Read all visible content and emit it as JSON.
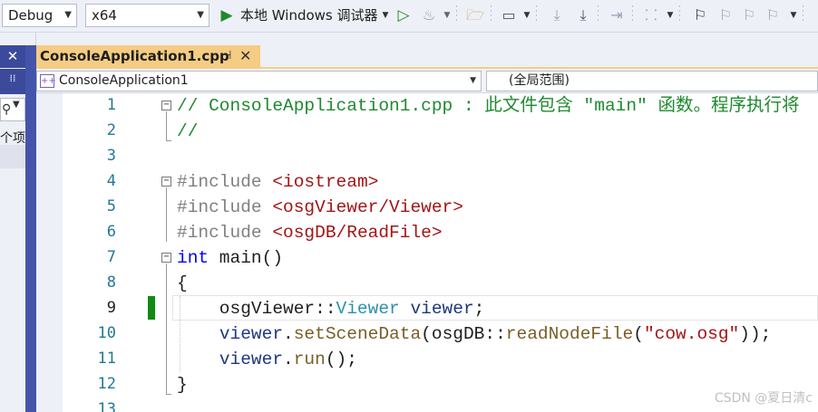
{
  "toolbar": {
    "config_value": "Debug",
    "platform_value": "x64",
    "run_target_label": "本地 Windows 调试器"
  },
  "left_panel": {
    "close_glyph": "✕",
    "truncated_label": "个项"
  },
  "tab": {
    "title": "ConsoleApplication1.cpp"
  },
  "navbar": {
    "project": "ConsoleApplication1",
    "scope": "(全局范围)"
  },
  "editor": {
    "line_numbers": [
      "1",
      "2",
      "3",
      "4",
      "5",
      "6",
      "7",
      "8",
      "9",
      "10",
      "11",
      "12",
      "13"
    ],
    "lines": [
      [
        {
          "t": "// ConsoleApplication1.cpp : 此文件包含 \"main\" 函数。程序执行将",
          "c": "cm"
        }
      ],
      [
        {
          "t": "//",
          "c": "cm"
        }
      ],
      [],
      [
        {
          "t": "#include ",
          "c": "pp"
        },
        {
          "t": "<iostream>",
          "c": "hd"
        }
      ],
      [
        {
          "t": "#include ",
          "c": "pp"
        },
        {
          "t": "<osgViewer/Viewer>",
          "c": "hd"
        }
      ],
      [
        {
          "t": "#include ",
          "c": "pp"
        },
        {
          "t": "<osgDB/ReadFile>",
          "c": "hd"
        }
      ],
      [
        {
          "t": "int",
          "c": "kw"
        },
        {
          "t": " main()",
          "c": ""
        }
      ],
      [
        {
          "t": "{",
          "c": ""
        }
      ],
      [
        {
          "t": "    osgViewer::",
          "c": ""
        },
        {
          "t": "Viewer",
          "c": "ty"
        },
        {
          "t": " ",
          "c": ""
        },
        {
          "t": "viewer",
          "c": "id"
        },
        {
          "t": ";",
          "c": ""
        }
      ],
      [
        {
          "t": "    ",
          "c": ""
        },
        {
          "t": "viewer",
          "c": "id"
        },
        {
          "t": ".",
          "c": ""
        },
        {
          "t": "setSceneData",
          "c": "fn"
        },
        {
          "t": "(osgDB::",
          "c": ""
        },
        {
          "t": "readNodeFile",
          "c": "fn"
        },
        {
          "t": "(",
          "c": ""
        },
        {
          "t": "\"cow.osg\"",
          "c": "str"
        },
        {
          "t": "));",
          "c": ""
        }
      ],
      [
        {
          "t": "    ",
          "c": ""
        },
        {
          "t": "viewer",
          "c": "id"
        },
        {
          "t": ".",
          "c": ""
        },
        {
          "t": "run",
          "c": "fn"
        },
        {
          "t": "();",
          "c": ""
        }
      ],
      [
        {
          "t": "}",
          "c": ""
        }
      ],
      []
    ]
  },
  "watermark": "CSDN @夏日清c"
}
